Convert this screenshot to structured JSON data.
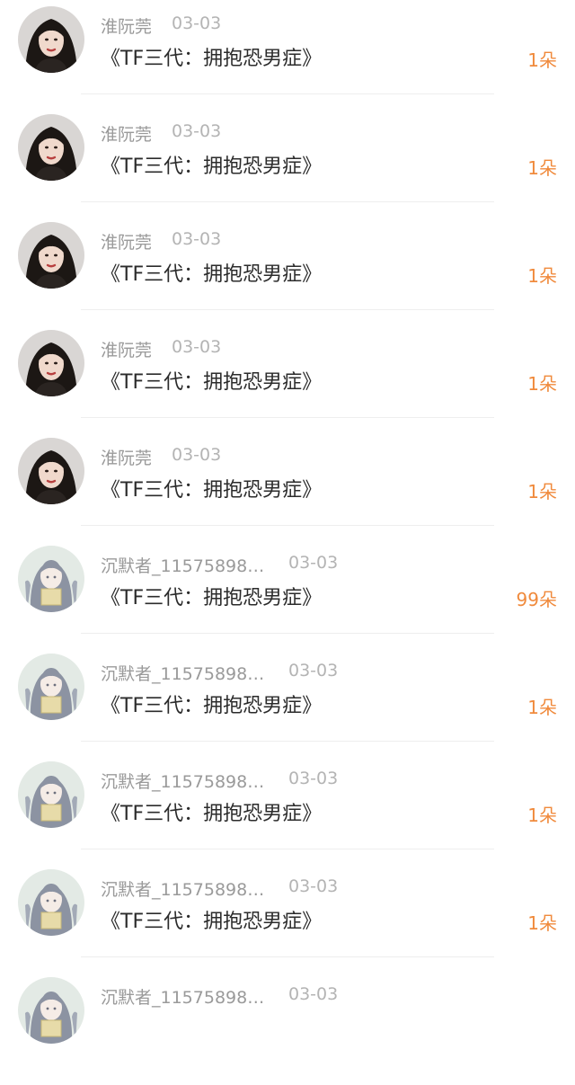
{
  "colors": {
    "gift": "#f08a3c",
    "name": "#9a9a9a",
    "date": "#b4b4b4",
    "title": "#2b2b2b",
    "divider": "#eeeeee"
  },
  "rows": [
    {
      "avatar": "portrait-avatar-1",
      "name": "淮阮莞",
      "date": "03-03",
      "title": "《TF三代：拥抱恐男症》",
      "gift": "1朵"
    },
    {
      "avatar": "portrait-avatar-1",
      "name": "淮阮莞",
      "date": "03-03",
      "title": "《TF三代：拥抱恐男症》",
      "gift": "1朵"
    },
    {
      "avatar": "portrait-avatar-1",
      "name": "淮阮莞",
      "date": "03-03",
      "title": "《TF三代：拥抱恐男症》",
      "gift": "1朵"
    },
    {
      "avatar": "portrait-avatar-1",
      "name": "淮阮莞",
      "date": "03-03",
      "title": "《TF三代：拥抱恐男症》",
      "gift": "1朵"
    },
    {
      "avatar": "portrait-avatar-1",
      "name": "淮阮莞",
      "date": "03-03",
      "title": "《TF三代：拥抱恐男症》",
      "gift": "1朵"
    },
    {
      "avatar": "illustration-avatar-2",
      "name": "沉默者_11575898…",
      "date": "03-03",
      "title": "《TF三代：拥抱恐男症》",
      "gift": "99朵"
    },
    {
      "avatar": "illustration-avatar-2",
      "name": "沉默者_11575898…",
      "date": "03-03",
      "title": "《TF三代：拥抱恐男症》",
      "gift": "1朵"
    },
    {
      "avatar": "illustration-avatar-2",
      "name": "沉默者_11575898…",
      "date": "03-03",
      "title": "《TF三代：拥抱恐男症》",
      "gift": "1朵"
    },
    {
      "avatar": "illustration-avatar-2",
      "name": "沉默者_11575898…",
      "date": "03-03",
      "title": "《TF三代：拥抱恐男症》",
      "gift": "1朵"
    },
    {
      "avatar": "illustration-avatar-2",
      "name": "沉默者_11575898…",
      "date": "03-03"
    }
  ]
}
